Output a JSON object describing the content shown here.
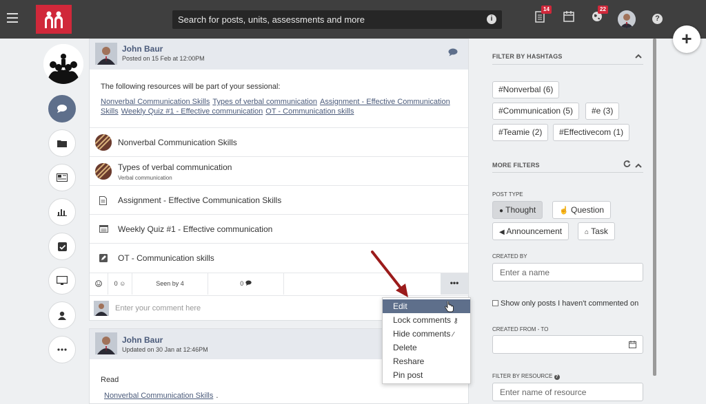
{
  "topbar": {
    "search_placeholder": "Search for posts, units, assessments and more",
    "notifications_badge": "14",
    "globe_badge": "22",
    "help_glyph": "?",
    "info_glyph": "i",
    "fab_glyph": "+"
  },
  "posts": [
    {
      "author": "John Baur",
      "posted": "Posted on 15 Feb at 12:00PM",
      "text": "The following resources will be part of your sessional:",
      "links": [
        "Nonverbal Communication Skills",
        "Types of verbal communication",
        "Assignment - Effective Communication Skills",
        "Weekly Quiz #1 - Effective communication",
        "OT - Communication skills"
      ],
      "resources": [
        {
          "title": "Nonverbal Communication Skills",
          "subtitle": "",
          "icon": "avatar"
        },
        {
          "title": "Types of verbal communication",
          "subtitle": "Verbal communication",
          "icon": "avatar"
        },
        {
          "title": "Assignment - Effective Communication Skills",
          "subtitle": "",
          "icon": "document-icon"
        },
        {
          "title": "Weekly Quiz #1 - Effective communication",
          "subtitle": "",
          "icon": "quiz-icon"
        },
        {
          "title": "OT - Communication skills",
          "subtitle": "",
          "icon": "pencil-icon"
        }
      ],
      "actions": {
        "reactions": "0",
        "seen": "Seen by 4",
        "comments": "0",
        "more": "•••"
      },
      "comment_placeholder": "Enter your comment here"
    },
    {
      "author": "John Baur",
      "posted": "Updated on 30 Jan at 12:46PM",
      "text": "Read",
      "links": [
        "Nonverbal Communication Skills"
      ],
      "link_suffix": "."
    }
  ],
  "dropdown": {
    "items": [
      "Edit",
      "Lock comments",
      "Hide comments",
      "Delete",
      "Reshare",
      "Pin post"
    ],
    "active_index": 0
  },
  "filters": {
    "hashtags_title": "FILTER BY HASHTAGS",
    "hashtags": [
      "#Nonverbal (6)",
      "#Communication (5)",
      "#e (3)",
      "#Teamie (2)",
      "#Effectivecom (1)"
    ],
    "more_title": "MORE FILTERS",
    "post_type_label": "POST TYPE",
    "post_types": [
      "Thought",
      "Question",
      "Announcement",
      "Task"
    ],
    "active_post_type": "Thought",
    "created_by_label": "CREATED BY",
    "created_by_placeholder": "Enter a name",
    "uncommented_label": "Show only posts I haven't commented on",
    "date_label": "CREATED FROM - TO",
    "resource_label": "FILTER BY RESOURCE",
    "resource_placeholder": "Enter name of resource"
  },
  "colors": {
    "brand": "#d0283a",
    "accent": "#5e6f8b",
    "link": "#4a5a7a"
  }
}
